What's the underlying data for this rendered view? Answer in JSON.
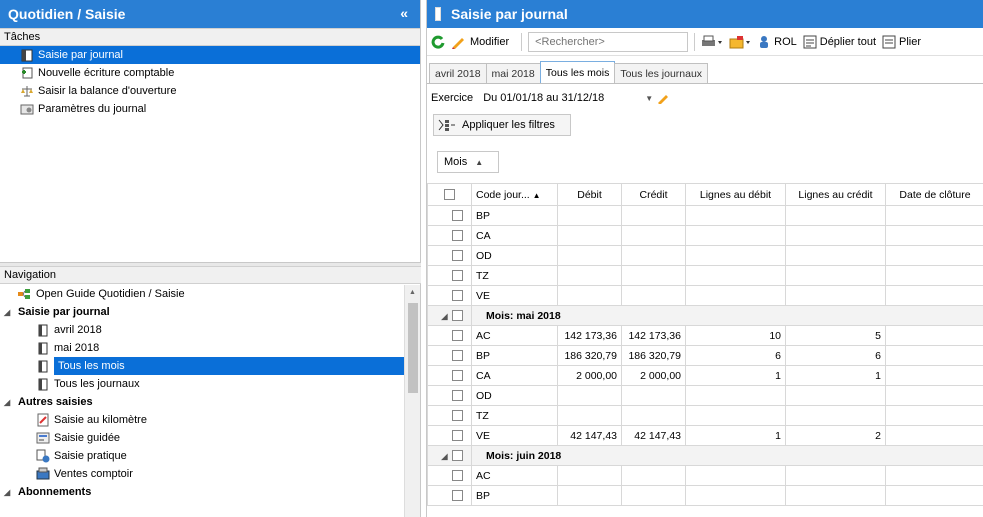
{
  "left": {
    "title": "Quotidien / Saisie",
    "collapse_glyph": "«",
    "tasks_header": "Tâches",
    "tasks": [
      {
        "label": "Saisie par journal",
        "icon": "journal-icon",
        "selected": true
      },
      {
        "label": "Nouvelle écriture comptable",
        "icon": "new-entry-icon",
        "selected": false
      },
      {
        "label": "Saisir la balance d'ouverture",
        "icon": "balance-icon",
        "selected": false
      },
      {
        "label": "Paramètres du journal",
        "icon": "settings-icon",
        "selected": false
      }
    ],
    "nav_header": "Navigation",
    "nav": {
      "open_guide": "Open Guide Quotidien / Saisie",
      "groups": [
        {
          "label": "Saisie par journal",
          "items": [
            "avril 2018",
            "mai 2018",
            "Tous les mois",
            "Tous les journaux"
          ],
          "selected": "Tous les mois"
        },
        {
          "label": "Autres saisies",
          "items": [
            "Saisie au kilomètre",
            "Saisie guidée",
            "Saisie pratique",
            "Ventes comptoir"
          ]
        },
        {
          "label": "Abonnements",
          "items": []
        }
      ]
    }
  },
  "right": {
    "title": "Saisie par journal",
    "toolbar": {
      "modify_label": "Modifier",
      "search_placeholder": "<Rechercher>",
      "rol_label": "ROL",
      "expand_label": "Déplier tout",
      "collapse_label": "Plier"
    },
    "tabs": [
      "avril 2018",
      "mai 2018",
      "Tous les mois",
      "Tous les journaux"
    ],
    "active_tab": "Tous les mois",
    "exercice_label": "Exercice",
    "exercice_value": "Du 01/01/18 au 31/12/18",
    "apply_filters_label": "Appliquer les filtres",
    "group_chip": "Mois",
    "columns": [
      "Code jour...",
      "Débit",
      "Crédit",
      "Lignes au débit",
      "Lignes au crédit",
      "Date de clôture"
    ],
    "rows_top": [
      {
        "code": "BP",
        "debit": "",
        "credit": "",
        "ld": "",
        "lc": "",
        "date": ""
      },
      {
        "code": "CA",
        "debit": "",
        "credit": "",
        "ld": "",
        "lc": "",
        "date": ""
      },
      {
        "code": "OD",
        "debit": "",
        "credit": "",
        "ld": "",
        "lc": "",
        "date": ""
      },
      {
        "code": "TZ",
        "debit": "",
        "credit": "",
        "ld": "",
        "lc": "",
        "date": ""
      },
      {
        "code": "VE",
        "debit": "",
        "credit": "",
        "ld": "",
        "lc": "",
        "date": ""
      }
    ],
    "group_may": "Mois: mai 2018",
    "rows_may": [
      {
        "code": "AC",
        "debit": "142 173,36",
        "credit": "142 173,36",
        "ld": "10",
        "lc": "5",
        "date": ""
      },
      {
        "code": "BP",
        "debit": "186 320,79",
        "credit": "186 320,79",
        "ld": "6",
        "lc": "6",
        "date": ""
      },
      {
        "code": "CA",
        "debit": "2 000,00",
        "credit": "2 000,00",
        "ld": "1",
        "lc": "1",
        "date": ""
      },
      {
        "code": "OD",
        "debit": "",
        "credit": "",
        "ld": "",
        "lc": "",
        "date": ""
      },
      {
        "code": "TZ",
        "debit": "",
        "credit": "",
        "ld": "",
        "lc": "",
        "date": ""
      },
      {
        "code": "VE",
        "debit": "42 147,43",
        "credit": "42 147,43",
        "ld": "1",
        "lc": "2",
        "date": ""
      }
    ],
    "group_june": "Mois: juin 2018",
    "rows_june": [
      {
        "code": "AC",
        "debit": "",
        "credit": "",
        "ld": "",
        "lc": "",
        "date": ""
      },
      {
        "code": "BP",
        "debit": "",
        "credit": "",
        "ld": "",
        "lc": "",
        "date": ""
      }
    ]
  },
  "colors": {
    "title_bar": "#2a7fd4",
    "selection": "#0a6fd8"
  }
}
